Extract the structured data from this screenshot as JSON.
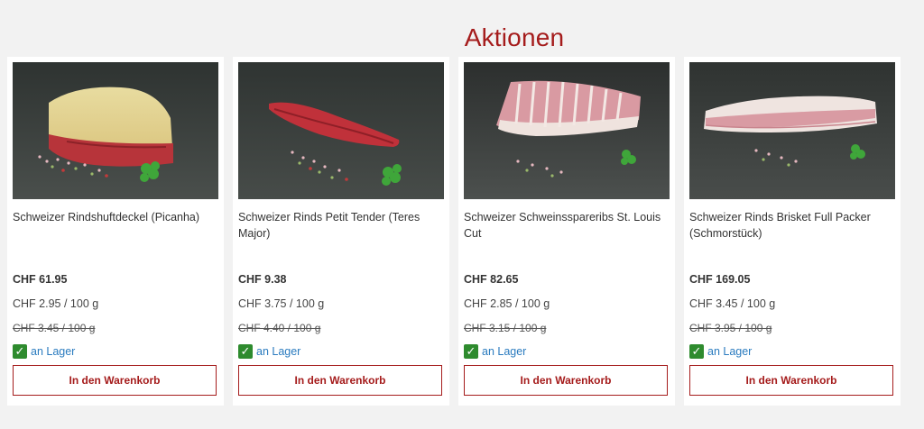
{
  "section": {
    "title": "Aktionen"
  },
  "products": [
    {
      "title": "Schweizer Rindshuftdeckel (Picanha)",
      "price": "CHF 61.95",
      "unit_price": "CHF 2.95 / 100 g",
      "old_unit_price": "CHF 3.45 / 100 g",
      "stock": "an Lager",
      "cart_label": "In den Warenkorb"
    },
    {
      "title": "Schweizer Rinds Petit Tender (Teres Major)",
      "price": "CHF 9.38",
      "unit_price": "CHF 3.75 / 100 g",
      "old_unit_price": "CHF 4.40 / 100 g",
      "stock": "an Lager",
      "cart_label": "In den Warenkorb"
    },
    {
      "title": "Schweizer Schweinsspareribs St. Louis Cut",
      "price": "CHF 82.65",
      "unit_price": "CHF 2.85 / 100 g",
      "old_unit_price": "CHF 3.15 / 100 g",
      "stock": "an Lager",
      "cart_label": "In den Warenkorb"
    },
    {
      "title": "Schweizer Rinds Brisket Full Packer (Schmorstück)",
      "price": "CHF 169.05",
      "unit_price": "CHF 3.45 / 100 g",
      "old_unit_price": "CHF 3.95 / 100 g",
      "stock": "an Lager",
      "cart_label": "In den Warenkorb"
    }
  ],
  "colors": {
    "accent": "#a51c1c",
    "stock_green": "#2e8b2e",
    "stock_text": "#2a7bbf",
    "background": "#f2f2f2"
  }
}
